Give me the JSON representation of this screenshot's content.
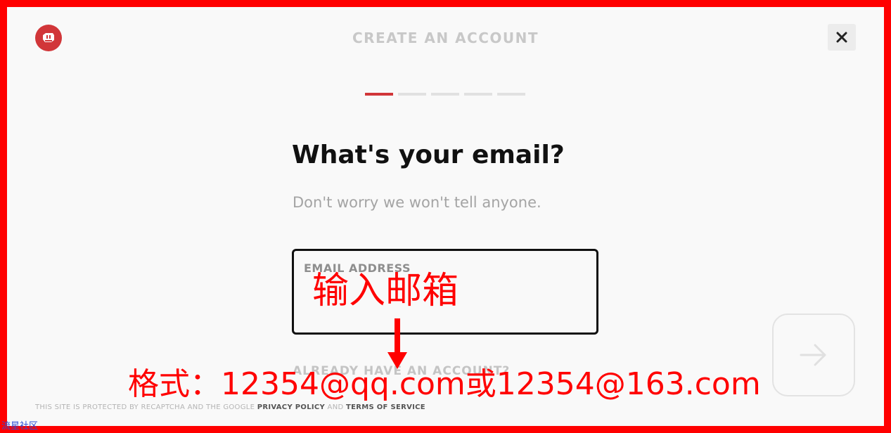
{
  "header": {
    "title": "CREATE AN ACCOUNT",
    "close_label": "✕"
  },
  "progress": {
    "total_steps": 5,
    "current_step": 1,
    "accent_color": "#d13639"
  },
  "form": {
    "heading": "What's your email?",
    "subheading": "Don't worry we won't tell anyone.",
    "email_label": "EMAIL ADDRESS",
    "email_value": "",
    "already_have_account": "ALREADY HAVE AN ACCOUNT?"
  },
  "annotations": {
    "input_email": "输入邮箱",
    "format": "格式：12354@qq.com或12354@163.com",
    "color": "#ff0000"
  },
  "footer": {
    "text_before": "THIS SITE IS PROTECTED BY RECAPTCHA AND THE GOOGLE ",
    "privacy_link": "PRIVACY POLICY",
    "text_middle": " AND ",
    "terms_link": "TERMS OF SERVICE"
  },
  "icons": {
    "logo": "riot-fist-logo-icon",
    "close": "close-icon",
    "next": "arrow-right-icon"
  },
  "watermark": "流星社区"
}
